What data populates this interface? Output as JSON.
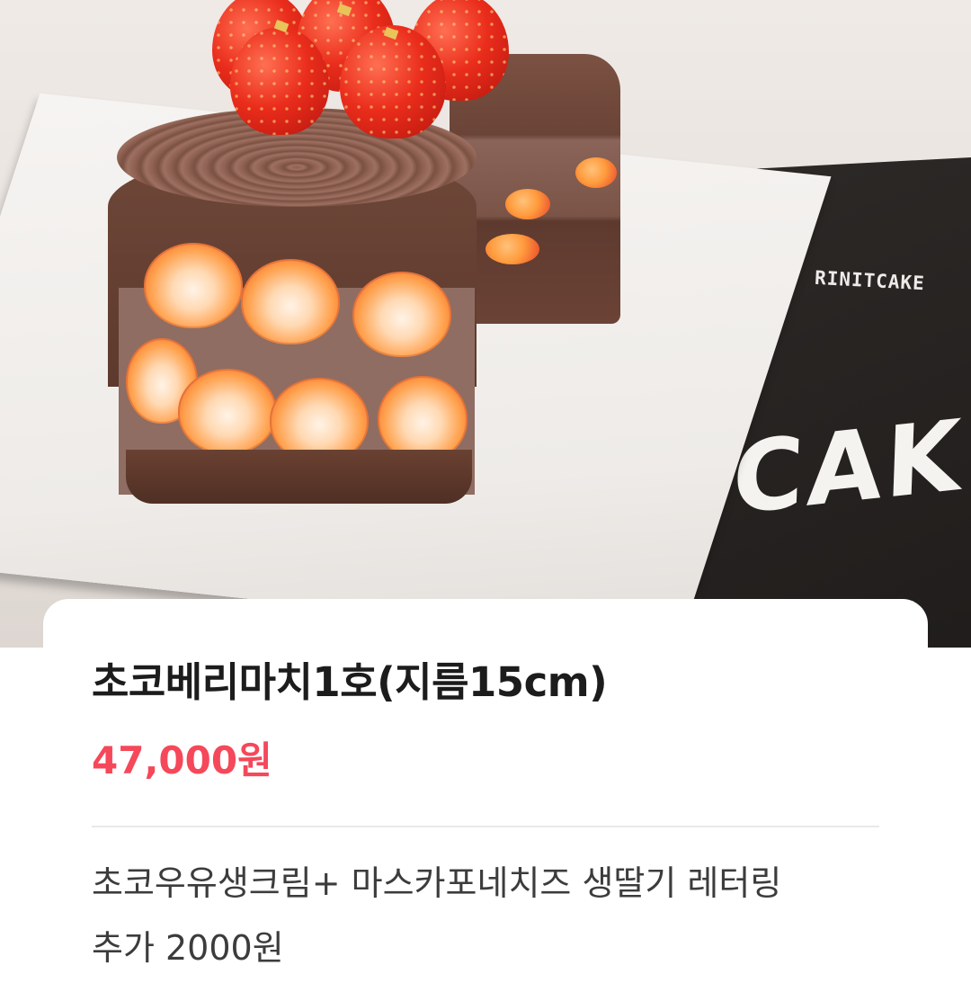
{
  "photo": {
    "brand_small": "RINITCAKE",
    "brand_large": "ICAKE"
  },
  "product": {
    "title": "초코베리마치1호(지름15cm)",
    "price": "47,000원",
    "description_lines": [
      "초코우유생크림+ 마스카포네치즈 생딸기 레터링",
      "추가 2000원"
    ]
  },
  "colors": {
    "price": "#f5485a",
    "title": "#1c1c1c",
    "description": "#3c3c3c",
    "divider": "#e9e9e9"
  }
}
